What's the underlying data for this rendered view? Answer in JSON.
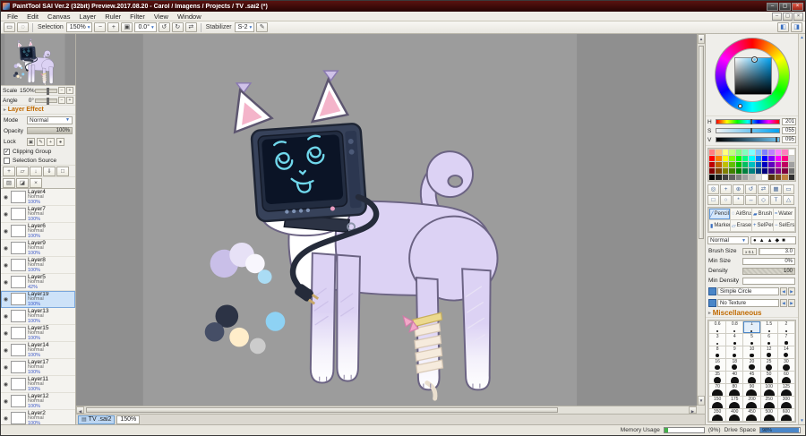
{
  "window": {
    "title": "PaintTool SAI Ver.2 (32bit) Preview.2017.08.20 - Carol / Imagens / Projects / TV .sai2 (*)"
  },
  "menu": {
    "items": [
      "File",
      "Edit",
      "Canvas",
      "Layer",
      "Ruler",
      "Filter",
      "View",
      "Window"
    ]
  },
  "toolbar": {
    "selection_label": "Selection",
    "zoom_value": "150%",
    "angle_value": "0.0°",
    "stabilizer_label": "Stabilizer",
    "stabilizer_value": "S-2"
  },
  "navigator": {
    "scale_label": "Scale",
    "scale_value": "150%",
    "angle_label": "Angle",
    "angle_value": "0°"
  },
  "layer_panel": {
    "section_label": "Layer Effect",
    "mode_label": "Mode",
    "mode_value": "Normal",
    "opacity_label": "Opacity",
    "opacity_value": "100%",
    "opacity_pct": 100,
    "lock_label": "Lock",
    "lock_icons": [
      {
        "name": "lock-opacity-icon",
        "glyph": "▣"
      },
      {
        "name": "lock-pixels-icon",
        "glyph": "✎"
      },
      {
        "name": "lock-position-icon",
        "glyph": "+"
      },
      {
        "name": "lock-all-icon",
        "glyph": "●"
      }
    ],
    "clipping_label": "Clipping Group",
    "clipping_checked": true,
    "selection_source_label": "Selection Source",
    "selection_source_checked": false,
    "action_rows": [
      [
        {
          "name": "new-layer-icon",
          "glyph": "+"
        },
        {
          "name": "new-folder-icon",
          "glyph": "▱"
        },
        {
          "name": "transfer-down-icon",
          "glyph": "↓"
        },
        {
          "name": "merge-down-icon",
          "glyph": "⇓"
        },
        {
          "name": "clear-layer-icon",
          "glyph": "□"
        }
      ],
      [
        {
          "name": "fill-layer-icon",
          "glyph": "▨"
        },
        {
          "name": "mask-icon",
          "glyph": "◪"
        },
        {
          "name": "delete-layer-icon",
          "glyph": "×"
        }
      ]
    ],
    "layers": [
      {
        "name": "Layer4",
        "mode": "Normal",
        "opacity": "100%"
      },
      {
        "name": "Layer7",
        "mode": "Normal",
        "opacity": "100%"
      },
      {
        "name": "Layer6",
        "mode": "Normal",
        "opacity": "100%"
      },
      {
        "name": "Layer9",
        "mode": "Normal",
        "opacity": "100%"
      },
      {
        "name": "Layer8",
        "mode": "Normal",
        "opacity": "100%"
      },
      {
        "name": "Layer5",
        "mode": "Normal",
        "opacity": "42%"
      },
      {
        "name": "Layer19",
        "mode": "Normal",
        "opacity": "100%",
        "selected": true
      },
      {
        "name": "Layer13",
        "mode": "Normal",
        "opacity": "100%"
      },
      {
        "name": "Layer15",
        "mode": "Normal",
        "opacity": "100%"
      },
      {
        "name": "Layer14",
        "mode": "Normal",
        "opacity": "100%"
      },
      {
        "name": "Layer17",
        "mode": "Normal",
        "opacity": "100%"
      },
      {
        "name": "Layer11",
        "mode": "Normal",
        "opacity": "100%"
      },
      {
        "name": "Layer12",
        "mode": "Normal",
        "opacity": "100%"
      },
      {
        "name": "Layer2",
        "mode": "Normal",
        "opacity": "100%"
      }
    ]
  },
  "canvas": {
    "tab_name": "TV .sai2",
    "tab_zoom": "150%"
  },
  "color_panel": {
    "current_color": "#6dc4f2",
    "hsv": [
      {
        "label": "H",
        "value": "201"
      },
      {
        "label": "S",
        "value": "055"
      },
      {
        "label": "V",
        "value": "095"
      }
    ],
    "swatches": [
      [
        "#ff8080",
        "#ffbf80",
        "#ffff80",
        "#bfff80",
        "#80ff80",
        "#80ffbf",
        "#80ffff",
        "#80bfff",
        "#8080ff",
        "#bf80ff",
        "#ff80ff",
        "#ff80bf",
        "#ffffff"
      ],
      [
        "#ff0000",
        "#ff8000",
        "#ffff00",
        "#80ff00",
        "#00ff00",
        "#00ff80",
        "#00ffff",
        "#0080ff",
        "#0000ff",
        "#8000ff",
        "#ff00ff",
        "#ff0080",
        "#d0d0d0"
      ],
      [
        "#bf0000",
        "#bf6000",
        "#bfbf00",
        "#60bf00",
        "#00bf00",
        "#00bf60",
        "#00bfbf",
        "#0060bf",
        "#0000bf",
        "#6000bf",
        "#bf00bf",
        "#bf0060",
        "#a0a0a0"
      ],
      [
        "#800000",
        "#804000",
        "#808000",
        "#408000",
        "#008000",
        "#008040",
        "#008080",
        "#004080",
        "#000080",
        "#400080",
        "#800080",
        "#800040",
        "#707070"
      ],
      [
        "#000000",
        "#202020",
        "#404040",
        "#606060",
        "#808080",
        "#a0a0a0",
        "#c0c0c0",
        "#e0e0e0",
        "#ffffff",
        "#503010",
        "#805020",
        "#c08040",
        "#303030"
      ]
    ]
  },
  "tool_panel": {
    "icon_rows": [
      [
        {
          "name": "eyedropper-icon",
          "glyph": "◎"
        },
        {
          "name": "hand-tool-icon",
          "glyph": "+"
        },
        {
          "name": "zoom-tool-icon",
          "glyph": "⊕"
        },
        {
          "name": "rotate-view-icon",
          "glyph": "↺"
        },
        {
          "name": "flip-view-icon",
          "glyph": "⇄"
        },
        {
          "name": "grid-icon",
          "glyph": "▦"
        },
        {
          "name": "crop-icon",
          "glyph": "▭"
        }
      ],
      [
        {
          "name": "select-rect-icon",
          "glyph": "□"
        },
        {
          "name": "select-lasso-icon",
          "glyph": "○"
        },
        {
          "name": "select-wand-icon",
          "glyph": "*"
        },
        {
          "name": "move-icon",
          "glyph": "↔"
        },
        {
          "name": "transform-icon",
          "glyph": "◇"
        },
        {
          "name": "text-icon",
          "glyph": "T"
        },
        {
          "name": "shape-icon",
          "glyph": "△"
        }
      ]
    ],
    "tools": [
      {
        "label": "Pencil",
        "icon": "╱",
        "selected": true
      },
      {
        "label": "AirBrush",
        "icon": "◌"
      },
      {
        "label": "Brush",
        "icon": "▰"
      },
      {
        "label": "Water",
        "icon": "≈"
      },
      {
        "label": "Marker",
        "icon": "▮"
      },
      {
        "label": "Eraser",
        "icon": "▱"
      },
      {
        "label": "SelPen",
        "icon": "+"
      },
      {
        "label": "SelErs",
        "icon": "−"
      }
    ],
    "blend_value": "Normal",
    "tip_shapes": [
      "●",
      "▲",
      "▲",
      "◆",
      "■"
    ],
    "brush_size_label": "Brush Size",
    "brush_size_unit": "x 0.1",
    "brush_size_value": "3.0",
    "brush_size_pct": 3,
    "min_size_label": "Min Size",
    "min_size_value": "0%",
    "min_size_pct": 0,
    "density_label": "Density",
    "density_value": "100",
    "density_pct": 100,
    "min_density_label": "Min Density",
    "min_density_pct": 0,
    "shape_value": "Simple Circle",
    "texture_value": "No Texture",
    "misc_label": "Miscellaneous",
    "size_presets": [
      "0.6",
      "0.8",
      "1",
      "1.5",
      "2",
      "3",
      "4",
      "5",
      "6",
      "7",
      "8",
      "9",
      "10",
      "12",
      "14",
      "16",
      "18",
      "20",
      "25",
      "30",
      "35",
      "40",
      "45",
      "50",
      "60",
      "70",
      "80",
      "90",
      "100",
      "125",
      "150",
      "175",
      "200",
      "250",
      "300",
      "350",
      "400",
      "450",
      "500",
      "600"
    ],
    "size_selected": "1"
  },
  "status_bar": {
    "memory_label": "Memory Usage",
    "memory_text": "(9%)",
    "memory_pct": 9,
    "drive_label": "Drive Space",
    "drive_text": "98%",
    "drive_pct": 98
  }
}
